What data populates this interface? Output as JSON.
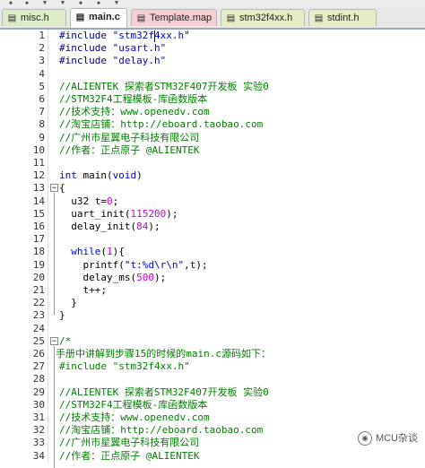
{
  "tabs": [
    {
      "label": "misc.h",
      "icon": "file-icon"
    },
    {
      "label": "main.c",
      "icon": "file-icon"
    },
    {
      "label": "Template.map",
      "icon": "file-icon"
    },
    {
      "label": "stm32f4xx.h",
      "icon": "file-icon"
    },
    {
      "label": "stdint.h",
      "icon": "file-icon"
    }
  ],
  "lines": [
    {
      "n": "1",
      "parts": [
        [
          "pre",
          "#include "
        ],
        [
          "str",
          "\"stm32f4xx.h\""
        ]
      ]
    },
    {
      "n": "2",
      "parts": [
        [
          "pre",
          "#include "
        ],
        [
          "str",
          "\"usart.h\""
        ]
      ]
    },
    {
      "n": "3",
      "parts": [
        [
          "pre",
          "#include "
        ],
        [
          "str",
          "\"delay.h\""
        ]
      ]
    },
    {
      "n": "4",
      "parts": []
    },
    {
      "n": "5",
      "parts": [
        [
          "cmt",
          "//ALIENTEK 探索者STM32F407开发板 实验0"
        ]
      ]
    },
    {
      "n": "6",
      "parts": [
        [
          "cmt",
          "//STM32F4工程模板-库函数版本"
        ]
      ]
    },
    {
      "n": "7",
      "parts": [
        [
          "cmt",
          "//技术支持：www.openedv.com"
        ]
      ]
    },
    {
      "n": "8",
      "parts": [
        [
          "cmt",
          "//淘宝店铺：http://eboard.taobao.com"
        ]
      ]
    },
    {
      "n": "9",
      "parts": [
        [
          "cmt",
          "//广州市星翼电子科技有限公司"
        ]
      ]
    },
    {
      "n": "10",
      "parts": [
        [
          "cmt",
          "//作者：正点原子 @ALIENTEK"
        ]
      ]
    },
    {
      "n": "11",
      "parts": []
    },
    {
      "n": "12",
      "parts": [
        [
          "kw",
          "int "
        ],
        [
          "txt",
          "main("
        ],
        [
          "kw",
          "void"
        ],
        [
          "txt",
          ")"
        ]
      ]
    },
    {
      "n": "13",
      "parts": [
        [
          "txt",
          "{"
        ]
      ]
    },
    {
      "n": "14",
      "parts": [
        [
          "txt",
          "  u32 t="
        ],
        [
          "num",
          "0"
        ],
        [
          "txt",
          ";"
        ]
      ]
    },
    {
      "n": "15",
      "parts": [
        [
          "txt",
          "  uart_init("
        ],
        [
          "num",
          "115200"
        ],
        [
          "txt",
          ");"
        ]
      ]
    },
    {
      "n": "16",
      "parts": [
        [
          "txt",
          "  delay_init("
        ],
        [
          "num",
          "84"
        ],
        [
          "txt",
          ");"
        ]
      ]
    },
    {
      "n": "17",
      "parts": []
    },
    {
      "n": "18",
      "parts": [
        [
          "txt",
          "  "
        ],
        [
          "kw",
          "while"
        ],
        [
          "txt",
          "("
        ],
        [
          "num",
          "1"
        ],
        [
          "txt",
          "){"
        ]
      ]
    },
    {
      "n": "19",
      "parts": [
        [
          "txt",
          "    printf("
        ],
        [
          "str",
          "\"t:%d\\r\\n\""
        ],
        [
          "txt",
          ",t);"
        ]
      ]
    },
    {
      "n": "20",
      "parts": [
        [
          "txt",
          "    delay_ms("
        ],
        [
          "num",
          "500"
        ],
        [
          "txt",
          ");"
        ]
      ]
    },
    {
      "n": "21",
      "parts": [
        [
          "txt",
          "    t++;"
        ]
      ]
    },
    {
      "n": "22",
      "parts": [
        [
          "txt",
          "  }"
        ]
      ]
    },
    {
      "n": "23",
      "parts": [
        [
          "txt",
          "}"
        ]
      ]
    },
    {
      "n": "24",
      "parts": []
    },
    {
      "n": "25",
      "parts": [
        [
          "cmt",
          "/*"
        ]
      ]
    },
    {
      "n": "26",
      "parts": [
        [
          "cmt",
          "手册中讲解到步骤15的时候的main.c源码如下："
        ]
      ],
      "outdent": true
    },
    {
      "n": "27",
      "parts": [
        [
          "cmt",
          "#include \"stm32f4xx.h\""
        ]
      ]
    },
    {
      "n": "28",
      "parts": []
    },
    {
      "n": "29",
      "parts": [
        [
          "cmt",
          "//ALIENTEK 探索者STM32F407开发板 实验0"
        ]
      ]
    },
    {
      "n": "30",
      "parts": [
        [
          "cmt",
          "//STM32F4工程模板-库函数版本"
        ]
      ]
    },
    {
      "n": "31",
      "parts": [
        [
          "cmt",
          "//技术支持：www.openedv.com"
        ]
      ]
    },
    {
      "n": "32",
      "parts": [
        [
          "cmt",
          "//淘宝店铺：http://eboard.taobao.com"
        ]
      ]
    },
    {
      "n": "33",
      "parts": [
        [
          "cmt",
          "//广州市星翼电子科技有限公司"
        ]
      ]
    },
    {
      "n": "34",
      "parts": [
        [
          "cmt",
          "//作者：正点原子 @ALIENTEK"
        ]
      ]
    }
  ],
  "watermark": "MCU杂谈",
  "colors": {
    "preprocessor": "#000080",
    "string": "#0000e0",
    "comment": "#008000",
    "keyword": "#0000ff",
    "number": "#d000d0"
  }
}
